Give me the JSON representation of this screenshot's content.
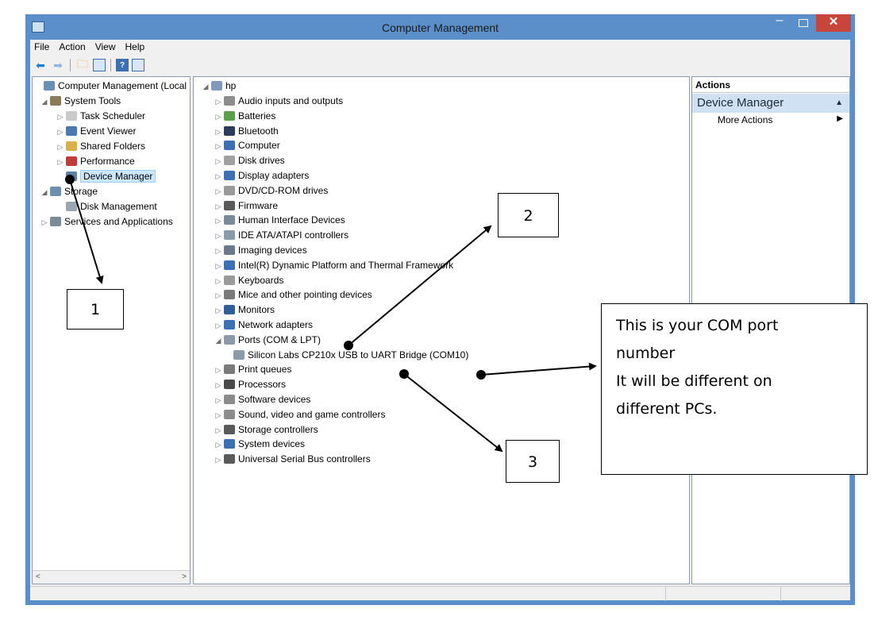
{
  "window": {
    "title": "Computer Management"
  },
  "menu": [
    "File",
    "Action",
    "View",
    "Help"
  ],
  "left_tree": [
    {
      "label": "Computer Management (Local",
      "level": 0,
      "expander": "",
      "icon": "computer-management-icon",
      "color": "#6a8fb5"
    },
    {
      "label": "System Tools",
      "level": 1,
      "expander": "◢",
      "icon": "tools-icon",
      "color": "#8a7a5a"
    },
    {
      "label": "Task Scheduler",
      "level": 2,
      "expander": "▷",
      "icon": "clock-icon",
      "color": "#c9c9c9"
    },
    {
      "label": "Event Viewer",
      "level": 2,
      "expander": "▷",
      "icon": "event-viewer-icon",
      "color": "#4a78b5"
    },
    {
      "label": "Shared Folders",
      "level": 2,
      "expander": "▷",
      "icon": "shared-folder-icon",
      "color": "#d9b04a"
    },
    {
      "label": "Performance",
      "level": 2,
      "expander": "▷",
      "icon": "performance-icon",
      "color": "#c23b3b"
    },
    {
      "label": "Device Manager",
      "level": 2,
      "expander": "",
      "icon": "device-manager-icon",
      "color": "#5a7fa8",
      "selected": true
    },
    {
      "label": "Storage",
      "level": 1,
      "expander": "◢",
      "icon": "storage-icon",
      "color": "#6f8fb0"
    },
    {
      "label": "Disk Management",
      "level": 2,
      "expander": "",
      "icon": "disk-icon",
      "color": "#9aa6b2"
    },
    {
      "label": "Services and Applications",
      "level": 1,
      "expander": "▷",
      "icon": "services-icon",
      "color": "#7d8a97"
    }
  ],
  "device_tree": {
    "root": "hp",
    "items": [
      {
        "label": "Audio inputs and outputs",
        "icon": "speaker-icon",
        "color": "#8c8c8c"
      },
      {
        "label": "Batteries",
        "icon": "battery-icon",
        "color": "#5aa04a"
      },
      {
        "label": "Bluetooth",
        "icon": "bluetooth-icon",
        "color": "#2a3e5c"
      },
      {
        "label": "Computer",
        "icon": "computer-icon",
        "color": "#3b6fb6"
      },
      {
        "label": "Disk drives",
        "icon": "disk-drive-icon",
        "color": "#a0a0a0"
      },
      {
        "label": "Display adapters",
        "icon": "display-adapter-icon",
        "color": "#3b6fb6"
      },
      {
        "label": "DVD/CD-ROM drives",
        "icon": "dvd-icon",
        "color": "#9a9a9a"
      },
      {
        "label": "Firmware",
        "icon": "firmware-icon",
        "color": "#5a5a5a"
      },
      {
        "label": "Human Interface Devices",
        "icon": "hid-icon",
        "color": "#7a8a9a"
      },
      {
        "label": "IDE ATA/ATAPI controllers",
        "icon": "ide-icon",
        "color": "#8a9aa8"
      },
      {
        "label": "Imaging devices",
        "icon": "imaging-icon",
        "color": "#6a7a8a"
      },
      {
        "label": "Intel(R) Dynamic Platform and Thermal Framework",
        "icon": "intel-icon",
        "color": "#3b6fb6"
      },
      {
        "label": "Keyboards",
        "icon": "keyboard-icon",
        "color": "#9a9a9a"
      },
      {
        "label": "Mice and other pointing devices",
        "icon": "mouse-icon",
        "color": "#7a7a7a"
      },
      {
        "label": "Monitors",
        "icon": "monitor-icon",
        "color": "#2f5f9a"
      },
      {
        "label": "Network adapters",
        "icon": "network-icon",
        "color": "#3b6fb6"
      },
      {
        "label": "Ports (COM & LPT)",
        "icon": "port-icon",
        "color": "#8a9aa8",
        "expanded": true
      },
      {
        "label": "Silicon Labs CP210x USB to UART Bridge (COM10)",
        "icon": "port-device-icon",
        "color": "#8a9aa8",
        "child": true
      },
      {
        "label": "Print queues",
        "icon": "printer-icon",
        "color": "#7a7a7a"
      },
      {
        "label": "Processors",
        "icon": "processor-icon",
        "color": "#4a4a4a"
      },
      {
        "label": "Software devices",
        "icon": "software-device-icon",
        "color": "#8a8a8a"
      },
      {
        "label": "Sound, video and game controllers",
        "icon": "sound-icon",
        "color": "#8c8c8c"
      },
      {
        "label": "Storage controllers",
        "icon": "storage-controller-icon",
        "color": "#5a5a5a"
      },
      {
        "label": "System devices",
        "icon": "system-device-icon",
        "color": "#3b6fb6"
      },
      {
        "label": "Universal Serial Bus controllers",
        "icon": "usb-icon",
        "color": "#5a5a5a"
      }
    ]
  },
  "actions": {
    "header": "Actions",
    "section": "Device Manager",
    "more": "More Actions"
  },
  "annotations": {
    "label_1": "1",
    "label_2": "2",
    "label_3": "3",
    "note_lines": [
      "This is your COM port",
      "number",
      "It will be different on",
      "different PCs."
    ]
  }
}
